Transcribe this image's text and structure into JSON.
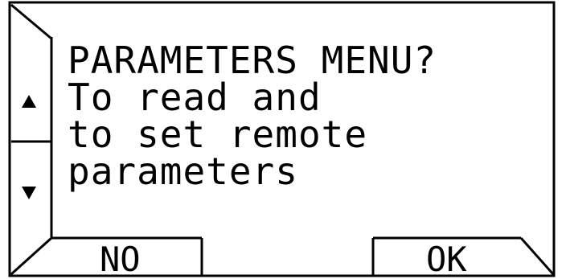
{
  "message": {
    "line1": "PARAMETERS MENU?",
    "line2": "To read and",
    "line3": "to set remote",
    "line4": "parameters"
  },
  "scroll": {
    "up_icon": "triangle-up",
    "down_icon": "triangle-down"
  },
  "softkeys": {
    "no_label": "NO",
    "ok_label": "OK"
  },
  "colors": {
    "foreground": "#000000",
    "background": "#ffffff"
  }
}
